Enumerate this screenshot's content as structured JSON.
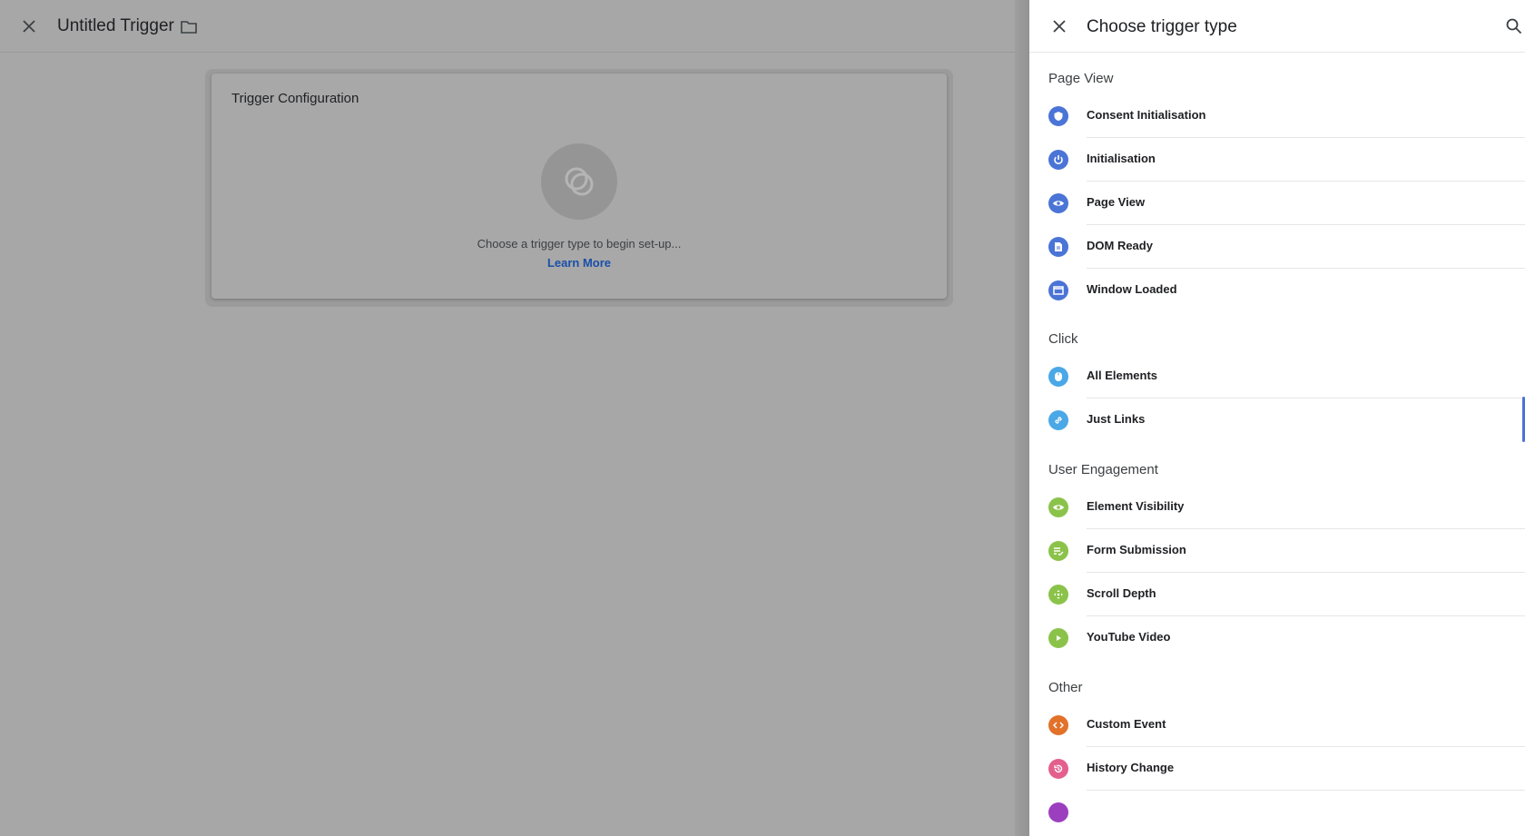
{
  "editor": {
    "title": "Untitled Trigger",
    "card_title": "Trigger Configuration",
    "hint": "Choose a trigger type to begin set-up...",
    "learn_more": "Learn More"
  },
  "panel": {
    "title": "Choose trigger type",
    "sections": [
      {
        "title": "Page View",
        "items": [
          {
            "label": "Consent Initialisation",
            "icon": "shield-icon",
            "color": "#4a74d6"
          },
          {
            "label": "Initialisation",
            "icon": "power-icon",
            "color": "#4a74d6"
          },
          {
            "label": "Page View",
            "icon": "eye-icon",
            "color": "#4a74d6"
          },
          {
            "label": "DOM Ready",
            "icon": "document-icon",
            "color": "#4a74d6"
          },
          {
            "label": "Window Loaded",
            "icon": "window-icon",
            "color": "#4a74d6"
          }
        ]
      },
      {
        "title": "Click",
        "items": [
          {
            "label": "All Elements",
            "icon": "mouse-icon",
            "color": "#4aa8e6"
          },
          {
            "label": "Just Links",
            "icon": "link-icon",
            "color": "#4aa8e6"
          }
        ]
      },
      {
        "title": "User Engagement",
        "items": [
          {
            "label": "Element Visibility",
            "icon": "eye-icon",
            "color": "#8bc34a"
          },
          {
            "label": "Form Submission",
            "icon": "form-check-icon",
            "color": "#8bc34a"
          },
          {
            "label": "Scroll Depth",
            "icon": "move-arrows-icon",
            "color": "#8bc34a"
          },
          {
            "label": "YouTube Video",
            "icon": "play-icon",
            "color": "#8bc34a"
          }
        ]
      },
      {
        "title": "Other",
        "items": [
          {
            "label": "Custom Event",
            "icon": "code-icon",
            "color": "#e2712a"
          },
          {
            "label": "History Change",
            "icon": "history-icon",
            "color": "#e45f8d"
          }
        ]
      }
    ]
  }
}
